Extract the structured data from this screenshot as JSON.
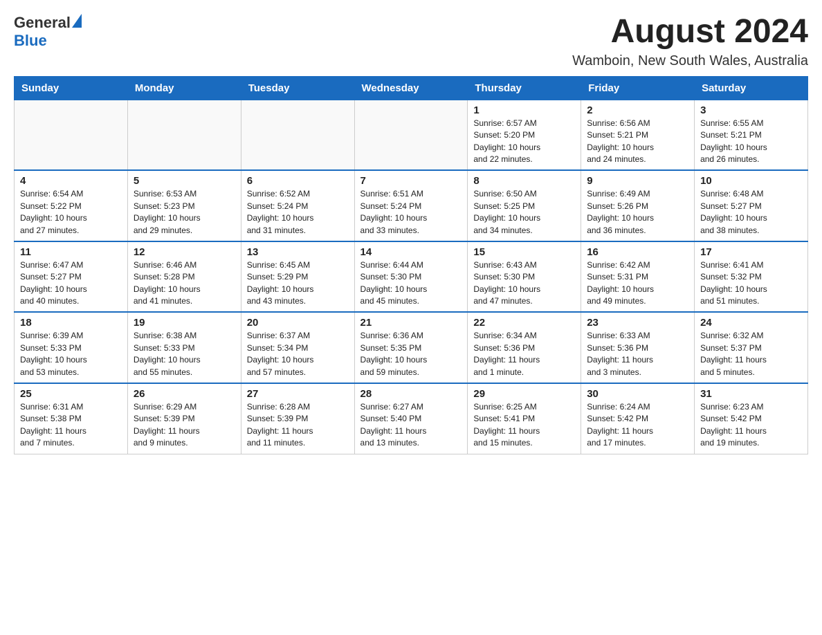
{
  "header": {
    "logo_general": "General",
    "logo_blue": "Blue",
    "month_title": "August 2024",
    "location": "Wamboin, New South Wales, Australia"
  },
  "weekdays": [
    "Sunday",
    "Monday",
    "Tuesday",
    "Wednesday",
    "Thursday",
    "Friday",
    "Saturday"
  ],
  "weeks": [
    [
      {
        "day": "",
        "info": ""
      },
      {
        "day": "",
        "info": ""
      },
      {
        "day": "",
        "info": ""
      },
      {
        "day": "",
        "info": ""
      },
      {
        "day": "1",
        "info": "Sunrise: 6:57 AM\nSunset: 5:20 PM\nDaylight: 10 hours\nand 22 minutes."
      },
      {
        "day": "2",
        "info": "Sunrise: 6:56 AM\nSunset: 5:21 PM\nDaylight: 10 hours\nand 24 minutes."
      },
      {
        "day": "3",
        "info": "Sunrise: 6:55 AM\nSunset: 5:21 PM\nDaylight: 10 hours\nand 26 minutes."
      }
    ],
    [
      {
        "day": "4",
        "info": "Sunrise: 6:54 AM\nSunset: 5:22 PM\nDaylight: 10 hours\nand 27 minutes."
      },
      {
        "day": "5",
        "info": "Sunrise: 6:53 AM\nSunset: 5:23 PM\nDaylight: 10 hours\nand 29 minutes."
      },
      {
        "day": "6",
        "info": "Sunrise: 6:52 AM\nSunset: 5:24 PM\nDaylight: 10 hours\nand 31 minutes."
      },
      {
        "day": "7",
        "info": "Sunrise: 6:51 AM\nSunset: 5:24 PM\nDaylight: 10 hours\nand 33 minutes."
      },
      {
        "day": "8",
        "info": "Sunrise: 6:50 AM\nSunset: 5:25 PM\nDaylight: 10 hours\nand 34 minutes."
      },
      {
        "day": "9",
        "info": "Sunrise: 6:49 AM\nSunset: 5:26 PM\nDaylight: 10 hours\nand 36 minutes."
      },
      {
        "day": "10",
        "info": "Sunrise: 6:48 AM\nSunset: 5:27 PM\nDaylight: 10 hours\nand 38 minutes."
      }
    ],
    [
      {
        "day": "11",
        "info": "Sunrise: 6:47 AM\nSunset: 5:27 PM\nDaylight: 10 hours\nand 40 minutes."
      },
      {
        "day": "12",
        "info": "Sunrise: 6:46 AM\nSunset: 5:28 PM\nDaylight: 10 hours\nand 41 minutes."
      },
      {
        "day": "13",
        "info": "Sunrise: 6:45 AM\nSunset: 5:29 PM\nDaylight: 10 hours\nand 43 minutes."
      },
      {
        "day": "14",
        "info": "Sunrise: 6:44 AM\nSunset: 5:30 PM\nDaylight: 10 hours\nand 45 minutes."
      },
      {
        "day": "15",
        "info": "Sunrise: 6:43 AM\nSunset: 5:30 PM\nDaylight: 10 hours\nand 47 minutes."
      },
      {
        "day": "16",
        "info": "Sunrise: 6:42 AM\nSunset: 5:31 PM\nDaylight: 10 hours\nand 49 minutes."
      },
      {
        "day": "17",
        "info": "Sunrise: 6:41 AM\nSunset: 5:32 PM\nDaylight: 10 hours\nand 51 minutes."
      }
    ],
    [
      {
        "day": "18",
        "info": "Sunrise: 6:39 AM\nSunset: 5:33 PM\nDaylight: 10 hours\nand 53 minutes."
      },
      {
        "day": "19",
        "info": "Sunrise: 6:38 AM\nSunset: 5:33 PM\nDaylight: 10 hours\nand 55 minutes."
      },
      {
        "day": "20",
        "info": "Sunrise: 6:37 AM\nSunset: 5:34 PM\nDaylight: 10 hours\nand 57 minutes."
      },
      {
        "day": "21",
        "info": "Sunrise: 6:36 AM\nSunset: 5:35 PM\nDaylight: 10 hours\nand 59 minutes."
      },
      {
        "day": "22",
        "info": "Sunrise: 6:34 AM\nSunset: 5:36 PM\nDaylight: 11 hours\nand 1 minute."
      },
      {
        "day": "23",
        "info": "Sunrise: 6:33 AM\nSunset: 5:36 PM\nDaylight: 11 hours\nand 3 minutes."
      },
      {
        "day": "24",
        "info": "Sunrise: 6:32 AM\nSunset: 5:37 PM\nDaylight: 11 hours\nand 5 minutes."
      }
    ],
    [
      {
        "day": "25",
        "info": "Sunrise: 6:31 AM\nSunset: 5:38 PM\nDaylight: 11 hours\nand 7 minutes."
      },
      {
        "day": "26",
        "info": "Sunrise: 6:29 AM\nSunset: 5:39 PM\nDaylight: 11 hours\nand 9 minutes."
      },
      {
        "day": "27",
        "info": "Sunrise: 6:28 AM\nSunset: 5:39 PM\nDaylight: 11 hours\nand 11 minutes."
      },
      {
        "day": "28",
        "info": "Sunrise: 6:27 AM\nSunset: 5:40 PM\nDaylight: 11 hours\nand 13 minutes."
      },
      {
        "day": "29",
        "info": "Sunrise: 6:25 AM\nSunset: 5:41 PM\nDaylight: 11 hours\nand 15 minutes."
      },
      {
        "day": "30",
        "info": "Sunrise: 6:24 AM\nSunset: 5:42 PM\nDaylight: 11 hours\nand 17 minutes."
      },
      {
        "day": "31",
        "info": "Sunrise: 6:23 AM\nSunset: 5:42 PM\nDaylight: 11 hours\nand 19 minutes."
      }
    ]
  ]
}
